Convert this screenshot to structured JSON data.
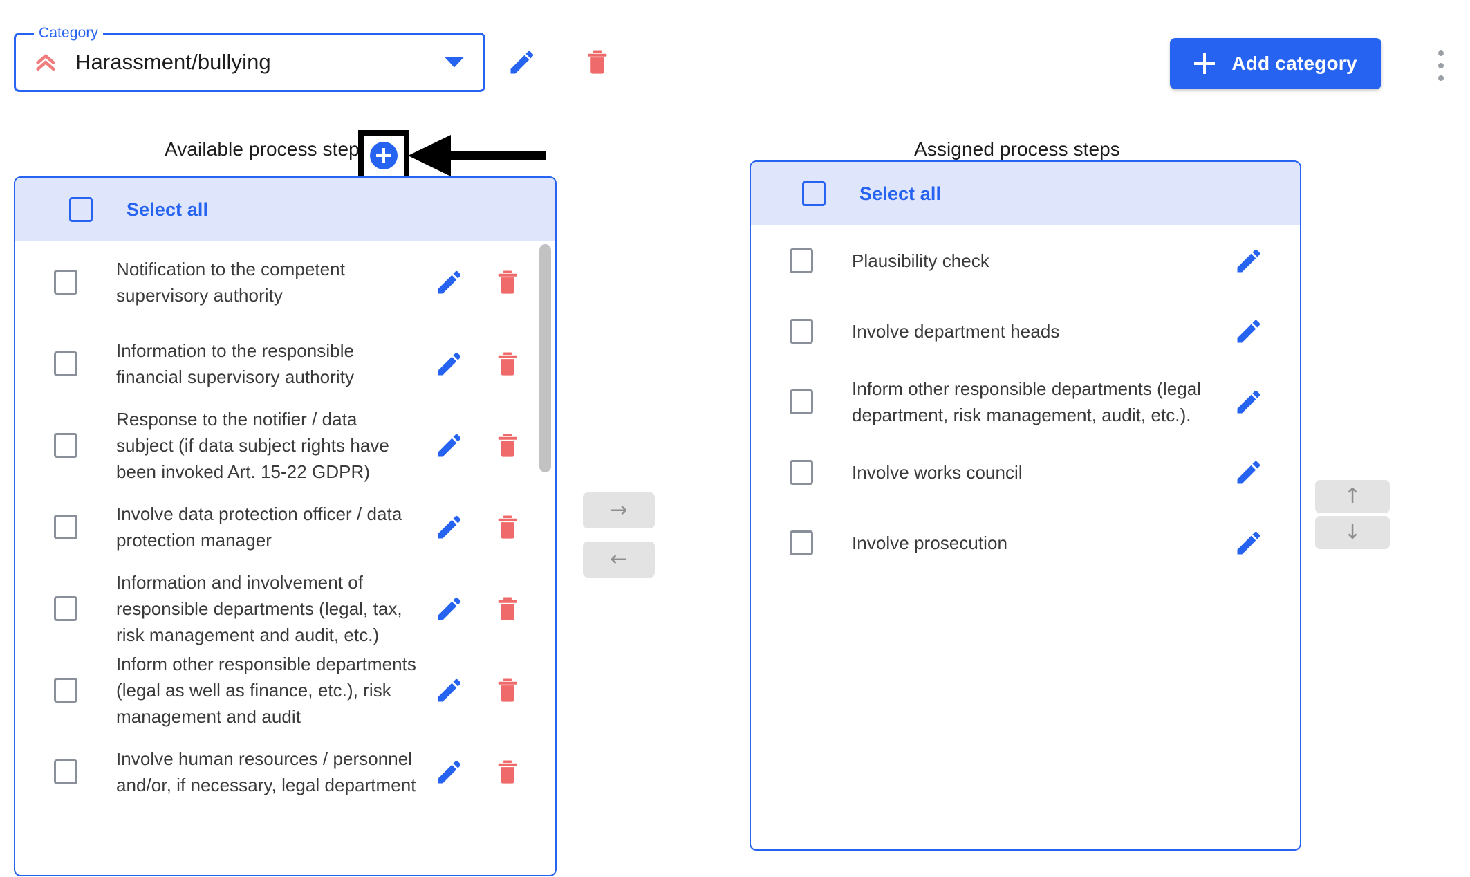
{
  "toolbar": {
    "category_label": "Category",
    "category_value": "Harassment/bullying",
    "priority_icon": "double-chevron-up-icon",
    "edit_icon": "pencil-icon",
    "delete_icon": "trash-icon",
    "add_category_label": "Add category",
    "overflow_icon": "kebab-menu-icon"
  },
  "left_panel": {
    "heading": "Available process steps",
    "add_step_icon": "plus-circle-icon",
    "select_all_label": "Select all",
    "items": [
      {
        "label": "Notification to the competent supervisory authority",
        "checked": false
      },
      {
        "label": "Information to the responsible financial supervisory authority",
        "checked": false
      },
      {
        "label": "Response to the notifier / data subject (if data subject rights have been invoked Art. 15-22 GDPR)",
        "checked": false
      },
      {
        "label": "Involve data protection officer / data protection manager",
        "checked": false
      },
      {
        "label": "Information and involvement of responsible departments (legal, tax, risk management and audit, etc.)",
        "checked": false
      },
      {
        "label": "Inform other responsible departments (legal as well as finance, etc.), risk management and audit",
        "checked": false
      },
      {
        "label": "Involve human resources / personnel and/or, if necessary, legal department",
        "checked": false
      }
    ]
  },
  "right_panel": {
    "heading": "Assigned process steps",
    "select_all_label": "Select all",
    "items": [
      {
        "label": "Plausibility check",
        "checked": false
      },
      {
        "label": "Involve department heads",
        "checked": false
      },
      {
        "label": "Inform other responsible departments (legal department, risk management, audit, etc.).",
        "checked": false
      },
      {
        "label": "Involve works council",
        "checked": false
      },
      {
        "label": "Involve prosecution",
        "checked": false
      }
    ]
  },
  "transfer": {
    "assign_label": "→",
    "unassign_label": "←",
    "move_up_label": "↑",
    "move_down_label": "↓"
  },
  "colors": {
    "accent_blue": "#2563f0",
    "header_blue": "#dfe6fb",
    "danger_red": "#ef6a6a",
    "muted_gray": "#e3e3e3"
  }
}
